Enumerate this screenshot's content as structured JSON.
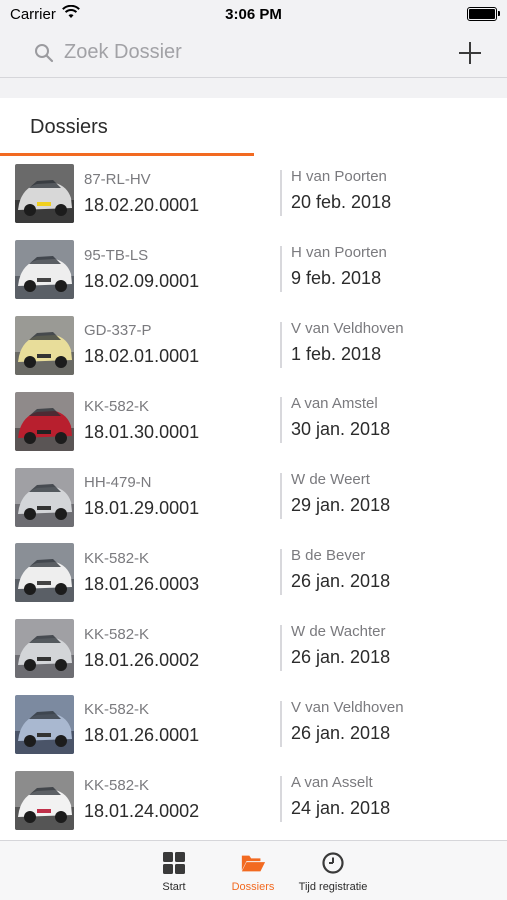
{
  "status": {
    "carrier": "Carrier",
    "time": "3:06 PM"
  },
  "search": {
    "placeholder": "Zoek Dossier"
  },
  "tabs": {
    "active_label": "Dossiers"
  },
  "colors": {
    "accent": "#f26a21",
    "text_primary": "#2b2b2b",
    "text_secondary": "#7a7a7e"
  },
  "dossiers": [
    {
      "plate": "87-RL-HV",
      "number": "18.02.20.0001",
      "owner": "H van Poorten",
      "date": "20 feb. 2018",
      "thumb": "car-front-photo"
    },
    {
      "plate": "95-TB-LS",
      "number": "18.02.09.0001",
      "owner": "H van Poorten",
      "date": "9 feb. 2018",
      "thumb": "car-white-photo"
    },
    {
      "plate": "GD-337-P",
      "number": "18.02.01.0001",
      "owner": "V van Veldhoven",
      "date": "1 feb. 2018",
      "thumb": "car-yellow-photo"
    },
    {
      "plate": "KK-582-K",
      "number": "18.01.30.0001",
      "owner": "A van Amstel",
      "date": "30 jan. 2018",
      "thumb": "car-red-photo"
    },
    {
      "plate": "HH-479-N",
      "number": "18.01.29.0001",
      "owner": "W de Weert",
      "date": "29 jan. 2018",
      "thumb": "car-silver-photo"
    },
    {
      "plate": "KK-582-K",
      "number": "18.01.26.0003",
      "owner": "B de Bever",
      "date": "26 jan. 2018",
      "thumb": "car-white-photo"
    },
    {
      "plate": "KK-582-K",
      "number": "18.01.26.0002",
      "owner": "W de Wachter",
      "date": "26 jan. 2018",
      "thumb": "car-silver-photo"
    },
    {
      "plate": "KK-582-K",
      "number": "18.01.26.0001",
      "owner": "V van Veldhoven",
      "date": "26 jan. 2018",
      "thumb": "car-blue-photo"
    },
    {
      "plate": "KK-582-K",
      "number": "18.01.24.0002",
      "owner": "A van Asselt",
      "date": "24 jan. 2018",
      "thumb": "car-white-red-photo"
    }
  ],
  "tabbar": {
    "start": {
      "label": "Start",
      "icon": "grid-icon"
    },
    "dossiers": {
      "label": "Dossiers",
      "icon": "folder-icon",
      "active": true
    },
    "tijd": {
      "label": "Tijd registratie",
      "icon": "clock-icon"
    }
  }
}
